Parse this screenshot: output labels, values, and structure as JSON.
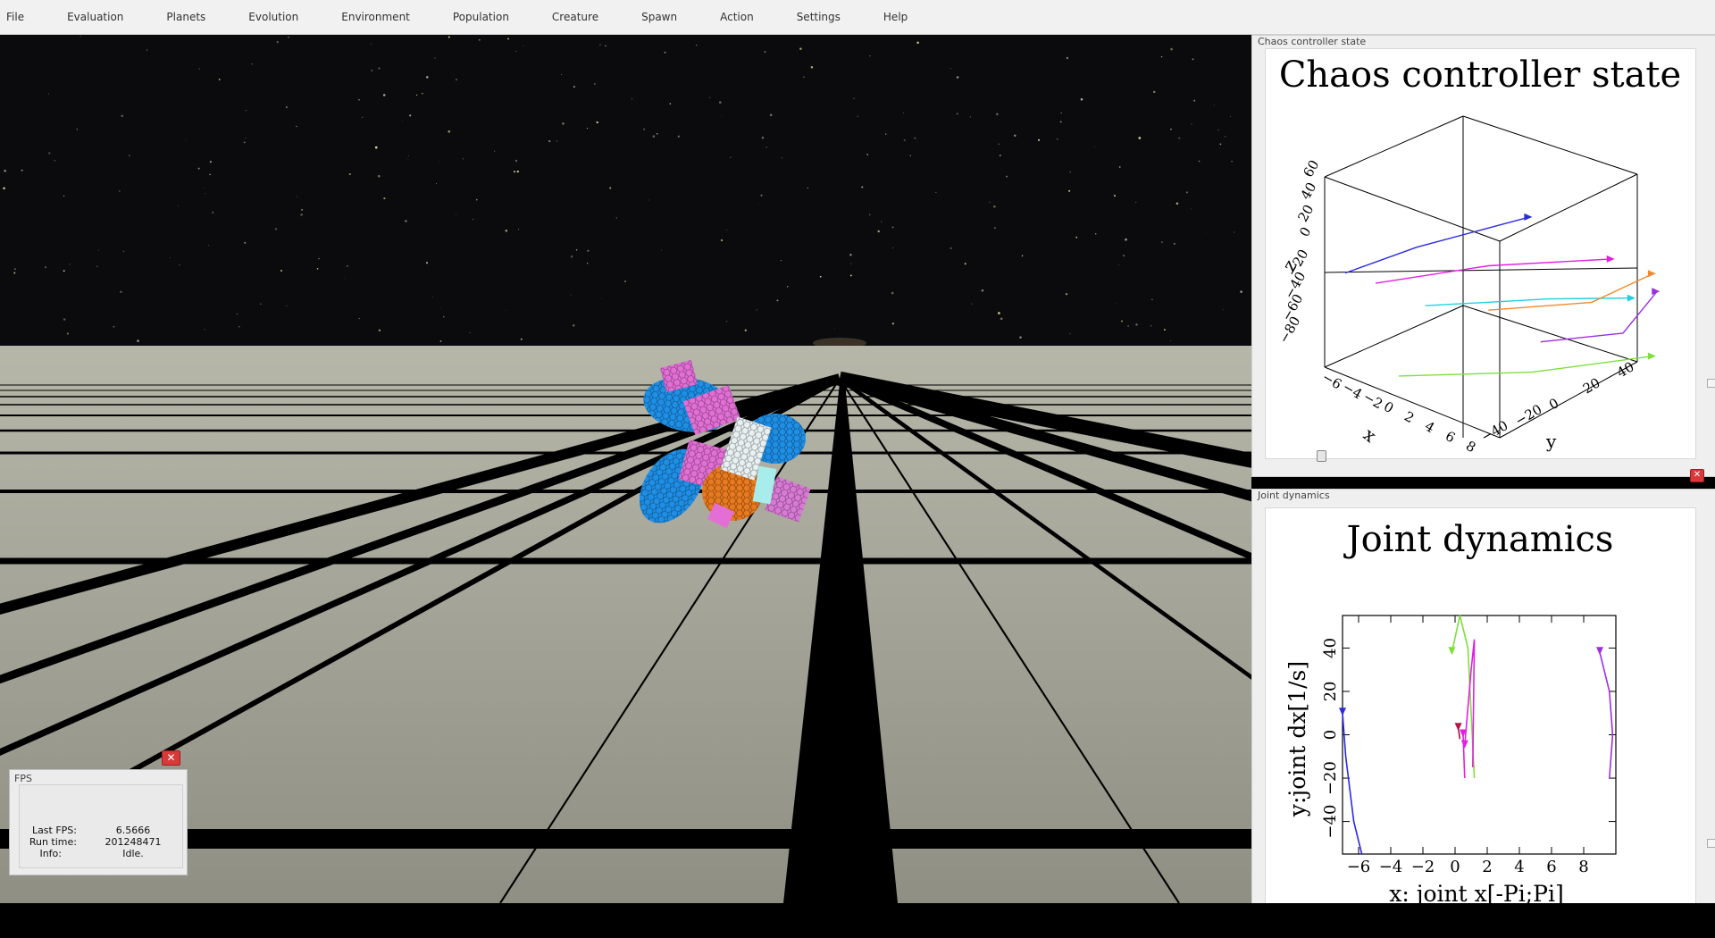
{
  "menu": [
    "File",
    "Evaluation",
    "Planets",
    "Evolution",
    "Environment",
    "Population",
    "Creature",
    "Spawn",
    "Action",
    "Settings",
    "Help"
  ],
  "colors": {
    "sky": "#0b0b0d",
    "ground": "#9e9e92",
    "grid": "#000000",
    "creature_blue": "#1e8fe6",
    "creature_pink": "#e36fd6",
    "creature_orange": "#e8791e",
    "creature_white": "#e8f0f2"
  },
  "chaos_panel": {
    "window_title": "Chaos controller state",
    "chart_title": "Chaos controller state",
    "axis_labels": {
      "x": "x",
      "y": "y",
      "z": "z"
    },
    "x_ticks": [
      "−6",
      "−4",
      "−2",
      "0",
      "2",
      "4",
      "6",
      "8"
    ],
    "y_ticks": [
      "−40",
      "−20",
      "0",
      "20",
      "40"
    ],
    "z_ticks": [
      "60",
      "40",
      "20",
      "0",
      "−20",
      "−40",
      "−60",
      "−80"
    ]
  },
  "joint_panel": {
    "window_title": "Joint dynamics",
    "chart_title": "Joint dynamics"
  },
  "chart_data": [
    {
      "type": "line",
      "title": "Chaos controller state",
      "xlabel": "x",
      "ylabel": "y",
      "zlabel": "z",
      "xlim": [
        -7,
        9
      ],
      "ylim": [
        -45,
        45
      ],
      "zlim": [
        -85,
        65
      ],
      "grid": false,
      "series": [
        {
          "color": "#2a2ae0",
          "points": [
            [
              -6,
              -40,
              -10
            ],
            [
              -3,
              -20,
              10
            ],
            [
              2,
              10,
              35
            ]
          ]
        },
        {
          "color": "#e020e0",
          "points": [
            [
              -5,
              -30,
              -20
            ],
            [
              0,
              0,
              -5
            ],
            [
              6,
              30,
              5
            ]
          ]
        },
        {
          "color": "#20d0e0",
          "points": [
            [
              -4,
              -10,
              -45
            ],
            [
              2,
              20,
              -35
            ],
            [
              7,
              35,
              -25
            ]
          ]
        },
        {
          "color": "#f08a30",
          "points": [
            [
              0,
              0,
              -40
            ],
            [
              5,
              25,
              -30
            ],
            [
              8,
              40,
              -5
            ]
          ]
        },
        {
          "color": "#9d2ee0",
          "points": [
            [
              3,
              10,
              -60
            ],
            [
              7,
              30,
              -50
            ],
            [
              8,
              42,
              -20
            ]
          ]
        },
        {
          "color": "#7ce03a",
          "points": [
            [
              -2,
              -35,
              -80
            ],
            [
              4,
              0,
              -75
            ],
            [
              8,
              40,
              -70
            ]
          ]
        }
      ]
    },
    {
      "type": "line",
      "title": "Joint dynamics",
      "xlabel": "x: joint x[-Pi;Pi]",
      "ylabel": "y:joint dx[1/s]",
      "xlim": [
        -7,
        10
      ],
      "ylim": [
        -55,
        55
      ],
      "x_ticks": [
        "−6",
        "−4",
        "−2",
        "0",
        "2",
        "4",
        "6",
        "8"
      ],
      "y_ticks": [
        "40",
        "20",
        "0",
        "−20",
        "−40"
      ],
      "grid": false,
      "series": [
        {
          "color": "#2a2ae0",
          "x": [
            -7,
            -6.8,
            -6.3,
            -5.8
          ],
          "y": [
            10,
            -10,
            -40,
            -55
          ]
        },
        {
          "color": "#7ce03a",
          "x": [
            -0.2,
            0.3,
            0.8,
            1.2
          ],
          "y": [
            38,
            55,
            40,
            -20
          ]
        },
        {
          "color": "#e020e0",
          "x": [
            0.6,
            1.0,
            1.2,
            1.1
          ],
          "y": [
            -5,
            30,
            44,
            -15
          ]
        },
        {
          "color": "#e020e0",
          "x": [
            0.5,
            0.55,
            0.6
          ],
          "y": [
            0,
            -10,
            -20
          ]
        },
        {
          "color": "#b0184a",
          "x": [
            0.2,
            0.3,
            0.25
          ],
          "y": [
            3,
            -2,
            1
          ]
        },
        {
          "color": "#9d2ee0",
          "x": [
            9,
            9.6,
            9.8,
            9.6
          ],
          "y": [
            38,
            20,
            0,
            -20
          ]
        }
      ]
    }
  ],
  "fps": {
    "title": "FPS",
    "last_fps_label": "Last FPS:",
    "last_fps": "6.5666",
    "run_time_label": "Run time:",
    "run_time": "201248471",
    "info_label": "Info:",
    "info": "Idle."
  }
}
